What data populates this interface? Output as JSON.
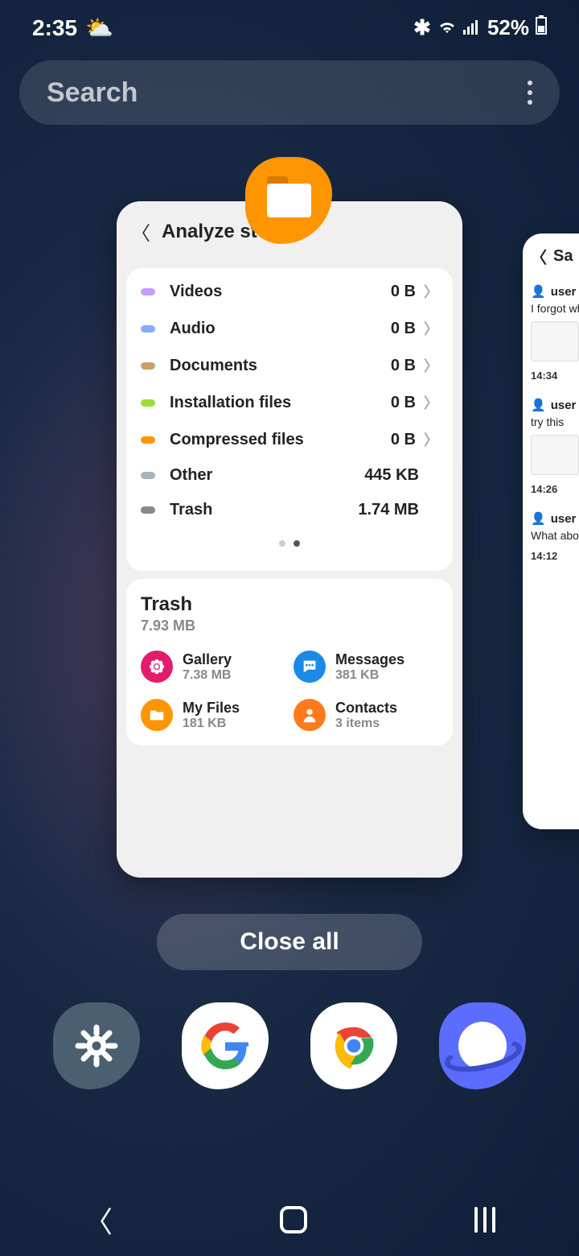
{
  "status": {
    "time": "2:35",
    "battery": "52%"
  },
  "search": {
    "placeholder": "Search"
  },
  "main_card": {
    "title": "Analyze storage",
    "rows": [
      {
        "label": "Videos",
        "size": "0 B",
        "color": "#c79cff",
        "chevron": true
      },
      {
        "label": "Audio",
        "size": "0 B",
        "color": "#8aa8ff",
        "chevron": true
      },
      {
        "label": "Documents",
        "size": "0 B",
        "color": "#c9a06a",
        "chevron": true
      },
      {
        "label": "Installation files",
        "size": "0 B",
        "color": "#9edc3e",
        "chevron": true
      },
      {
        "label": "Compressed files",
        "size": "0 B",
        "color": "#ff9500",
        "chevron": true
      },
      {
        "label": "Other",
        "size": "445 KB",
        "color": "#a8b4bd",
        "chevron": false
      },
      {
        "label": "Trash",
        "size": "1.74 MB",
        "color": "#888",
        "chevron": false
      }
    ],
    "trash": {
      "title": "Trash",
      "size": "7.93 MB",
      "items": [
        {
          "name": "Gallery",
          "sub": "7.38 MB",
          "color": "#e31b6d",
          "icon": "flower"
        },
        {
          "name": "Messages",
          "sub": "381 KB",
          "color": "#1b8ae3",
          "icon": "chat"
        },
        {
          "name": "My Files",
          "sub": "181 KB",
          "color": "#ff9500",
          "icon": "folder"
        },
        {
          "name": "Contacts",
          "sub": "3 items",
          "color": "#ff7a1a",
          "icon": "person"
        }
      ]
    }
  },
  "secondary_card": {
    "title": "Sa",
    "chats": [
      {
        "user": "user",
        "msg": "I forgot whats in",
        "time": "14:34",
        "thumb": true
      },
      {
        "user": "user",
        "msg": "try this",
        "time": "14:26",
        "thumb": true
      },
      {
        "user": "user",
        "msg": "What abo microsof",
        "time": "14:12",
        "thumb": false
      }
    ]
  },
  "close_all": "Close all"
}
